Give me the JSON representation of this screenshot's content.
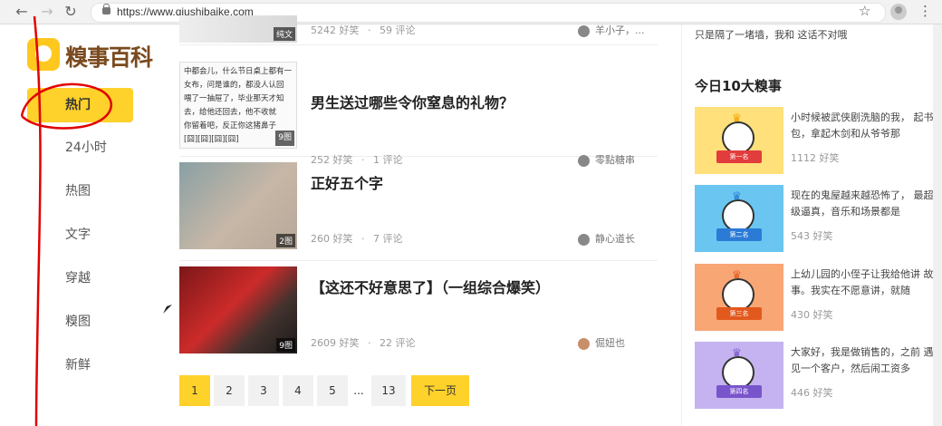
{
  "browser": {
    "url": "https://www.qiushibaike.com"
  },
  "sidebar": {
    "logo_text": "糗事百科",
    "items": [
      {
        "label": "热门",
        "active": true
      },
      {
        "label": "24小时"
      },
      {
        "label": "热图"
      },
      {
        "label": "文字"
      },
      {
        "label": "穿越"
      },
      {
        "label": "糗图"
      },
      {
        "label": "新鲜"
      }
    ]
  },
  "articles": [
    {
      "title": "",
      "laughs": "5242 好笑",
      "comments": "59 评论",
      "author": "羊小子，...",
      "badge": "纯文"
    },
    {
      "title": "男生送过哪些令你窒息的礼物？",
      "laughs": "252 好笑",
      "comments": "1 评论",
      "author": "零點糖串",
      "badge": "9图",
      "thumb_lines": [
        "中都会儿，什么节日桌上都有一",
        "女布，问是谁的，都没人认回",
        "喂了一抽屉了，毕业那天才知",
        "去，给他还回去，他不收就",
        "你留着吧，反正你这猪鼻子",
        "[囧][囧][囧][囧]"
      ]
    },
    {
      "title": "正好五个字",
      "laughs": "260 好笑",
      "comments": "7 评论",
      "author": "静心道长",
      "badge": "2图"
    },
    {
      "title": "【这还不好意思了】（一组综合爆笑）",
      "laughs": "2609 好笑",
      "comments": "22 评论",
      "author": "倔妞也",
      "badge": "9图"
    }
  ],
  "pagination": {
    "pages": [
      "1",
      "2",
      "3",
      "4",
      "5",
      "...",
      "13"
    ],
    "next": "下一页"
  },
  "right_panel": {
    "top_snippet": "只是隔了一堵墙，我和    这话不对哦",
    "title": "今日10大糗事",
    "items": [
      {
        "text": "小时候被武侠剧洗脑的我，   起书包，拿起木剑和从爷爷那",
        "laughs": "1112 好笑",
        "rank": "第一名",
        "color": "#ffe07a",
        "ribbon": "#e23d3d"
      },
      {
        "text": "现在的鬼屋越来越恐怖了，   最超级逼真，音乐和场景都是",
        "laughs": "543 好笑",
        "rank": "第二名",
        "color": "#6ac6f0",
        "ribbon": "#2b7bd6"
      },
      {
        "text": "上幼儿园的小侄子让我给他讲   故事。我实在不愿意讲，就随",
        "laughs": "430 好笑",
        "rank": "第三名",
        "color": "#f9a675",
        "ribbon": "#e2591e"
      },
      {
        "text": "大家好，我是做销售的，之前   遇见一个客户，然后闹工资多",
        "laughs": "446 好笑",
        "rank": "第四名",
        "color": "#c4b3f0",
        "ribbon": "#7955cc"
      }
    ]
  }
}
